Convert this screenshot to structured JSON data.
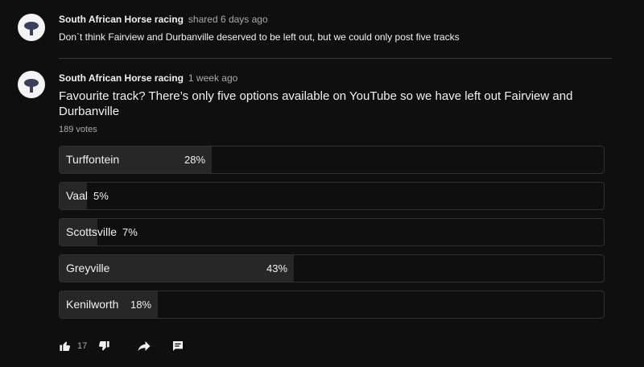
{
  "comment": {
    "author": "South African Horse racing",
    "timestamp": "shared 6 days ago",
    "text": "Don`t think Fairview and Durbanville deserved to be left out, but we could only post five tracks"
  },
  "poll_post": {
    "author": "South African Horse racing",
    "timestamp": "1 week ago",
    "question": "Favourite track? There’s only five options available on YouTube so we have left out Fairview and Durbanville",
    "votes": "189 votes",
    "options": [
      {
        "label": "Turffontein",
        "percent_label": "28%",
        "percent": 28
      },
      {
        "label": "Vaal",
        "percent_label": "5%",
        "percent": 5
      },
      {
        "label": "Scottsville",
        "percent_label": "7%",
        "percent": 7
      },
      {
        "label": "Greyville",
        "percent_label": "43%",
        "percent": 43
      },
      {
        "label": "Kenilworth",
        "percent_label": "18%",
        "percent": 18
      }
    ],
    "actions": {
      "like_icon": "thumb-up-icon",
      "like_count": "17",
      "dislike_icon": "thumb-down-icon",
      "share_icon": "share-icon",
      "comment_icon": "comment-icon"
    }
  },
  "colors": {
    "background": "#0f0f0f",
    "bar_fill": "#272727",
    "bar_border": "#303030",
    "text_primary": "#f1f1f1",
    "text_secondary": "#aaaaaa"
  }
}
